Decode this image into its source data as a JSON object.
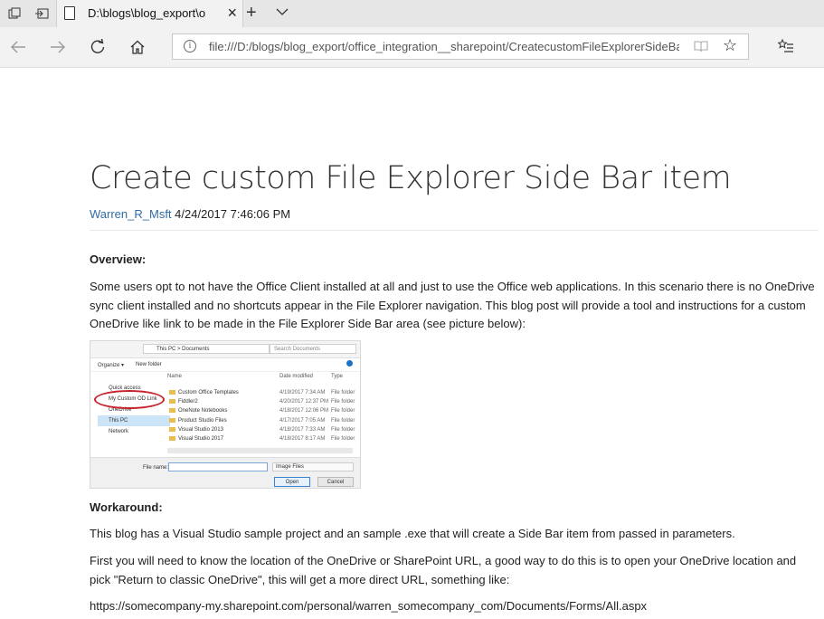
{
  "browser": {
    "tab_title": "D:\\blogs\\blog_export\\o",
    "close_glyph": "×",
    "new_tab_glyph": "+",
    "url": "file:///D:/blogs/blog_export/office_integration__sharepoint/CreatecustomFileExplorerSideBar",
    "info_glyph": "i",
    "favorite_glyph": "☆"
  },
  "article": {
    "title": "Create custom File Explorer Side Bar item",
    "author": "Warren_R_Msft",
    "date": "4/24/2017 7:46:06 PM",
    "overview_heading": "Overview:",
    "overview_text": "Some users opt to not have the Office Client installed at all and just to use the Office web applications.  In this scenario there is no OneDrive sync client installed and no shortcuts appear in the File Explorer navigation.   This blog post will provide a tool and instructions for a custom OneDrive like link to be made in the File Explorer Side Bar area (see picture below):",
    "workaround_heading": "Workaround:",
    "workaround_p1": "This blog has a Visual Studio sample project and an sample .exe that will create a Side Bar item from passed in parameters.",
    "workaround_p2": "First you will need to know the location of the OneDrive or SharePoint URL, a good way to do this is to open your OneDrive location and pick \"Return to classic OneDrive\", this will get a more direct URL, something like:",
    "example_url": "https://somecompany-my.sharepoint.com/personal/warren_somecompany_com/Documents/Forms/All.aspx"
  },
  "dialog": {
    "breadcrumb": "This PC  >  Documents",
    "search_placeholder": "Search Documents",
    "organize": "Organize ▾",
    "new_folder": "New folder",
    "columns": [
      "Name",
      "Date modified",
      "Type"
    ],
    "sidebar": [
      "Quick access",
      "My Custom OD Link",
      "OneDrive",
      "This PC",
      "Network"
    ],
    "files": [
      {
        "name": "Custom Office Templates",
        "date": "4/19/2017 7:34 AM",
        "type": "File folder"
      },
      {
        "name": "Fiddler2",
        "date": "4/20/2017 12:37 PM",
        "type": "File folder"
      },
      {
        "name": "OneNote Notebooks",
        "date": "4/18/2017 12:06 PM",
        "type": "File folder"
      },
      {
        "name": "Product Studio Files",
        "date": "4/17/2017 7:05 AM",
        "type": "File folder"
      },
      {
        "name": "Visual Studio 2013",
        "date": "4/18/2017 7:33 AM",
        "type": "File folder"
      },
      {
        "name": "Visual Studio 2017",
        "date": "4/18/2017 8:17 AM",
        "type": "File folder"
      }
    ],
    "file_name_label": "File name:",
    "file_type": "Image Files",
    "open_button": "Open",
    "cancel_button": "Cancel"
  }
}
